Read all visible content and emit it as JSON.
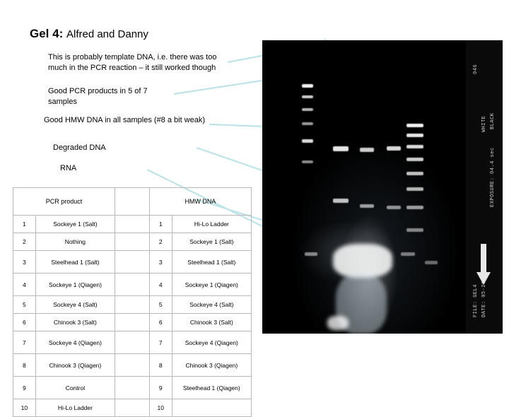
{
  "slide": {
    "title_bold": "Gel 4:",
    "title_rest": "Alfred and Danny"
  },
  "annotations": {
    "template_dna": "This is probably template DNA, i.e. there was too much in the PCR reaction – it still worked though",
    "pcr_products": "Good PCR products in 5 of 7 samples",
    "hmw_dna": "Good HMW DNA in all samples (#8 a bit weak)",
    "degraded_dna": "Degraded DNA",
    "rna": "RNA"
  },
  "table": {
    "header_left": "PCR product",
    "header_right": "HMW DNA",
    "rows": [
      {
        "lnum": "1",
        "lname": "Sockeye 1 (Salt)",
        "rnum": "1",
        "rname": "Hi-Lo Ladder"
      },
      {
        "lnum": "2",
        "lname": "Nothing",
        "rnum": "2",
        "rname": "Sockeye 1 (Salt)"
      },
      {
        "lnum": "3",
        "lname": "Steelhead 1 (Salt)",
        "rnum": "3",
        "rname": "Steelhead 1 (Salt)"
      },
      {
        "lnum": "4",
        "lname": "Sockeye 1 (Qiagen)",
        "rnum": "4",
        "rname": "Sockeye 1 (Qiagen)"
      },
      {
        "lnum": "5",
        "lname": "Sockeye 4 (Salt)",
        "rnum": "5",
        "rname": "Sockeye 4 (Salt)"
      },
      {
        "lnum": "6",
        "lname": "Chinook 3 (Salt)",
        "rnum": "6",
        "rname": "Chinook 3 (Salt)"
      },
      {
        "lnum": "7",
        "lname": "Sockeye 4 (Qiagen)",
        "rnum": "7",
        "rname": "Sockeye 4 (Qiagen)"
      },
      {
        "lnum": "8",
        "lname": "Chinook 3 (Qiagen)",
        "rnum": "8",
        "rname": "Chinook 3 (Qiagen)"
      },
      {
        "lnum": "9",
        "lname": "Control",
        "rnum": "9",
        "rname": "Steelhead 1 (Qiagen)"
      },
      {
        "lnum": "10",
        "lname": "Hi-Lo Ladder",
        "rnum": "10",
        "rname": ""
      }
    ]
  },
  "gel": {
    "side_text_1": "FILE: GEL4",
    "side_text_2": "DATE: 05-26",
    "side_text_3": "EXPOSURE: 04.4 sec",
    "side_text_4": "BLACK",
    "side_text_5": "WHITE",
    "corner_code": "046"
  },
  "colors": {
    "leader_line": "#bfe3e8",
    "table_border": "#b8b8b8",
    "gel_background": "#000000"
  }
}
